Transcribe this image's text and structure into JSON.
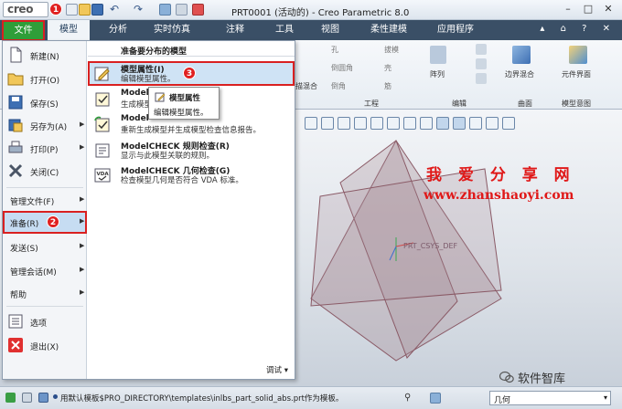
{
  "window": {
    "app_logo": "creo",
    "title": "PRT0001 (活动的) - Creo Parametric 8.0"
  },
  "ribbon": {
    "file_tab": "文件",
    "tabs": [
      "模型",
      "分析",
      "实时仿真",
      "注释",
      "工具",
      "视图",
      "柔性建模",
      "应用程序"
    ],
    "active_tab": "模型",
    "items": [
      "孔",
      "拔模",
      "倒圆角",
      "壳",
      "倒角",
      "筋",
      "阵列",
      "描混合",
      "边界混合",
      "元件界面"
    ],
    "groups": [
      "工程",
      "编辑",
      "曲面",
      "模型意图"
    ]
  },
  "file_menu": {
    "items": [
      {
        "label": "新建(N)",
        "icon": "new-file-icon",
        "arrow": false
      },
      {
        "label": "打开(O)",
        "icon": "open-folder-icon",
        "arrow": false
      },
      {
        "label": "保存(S)",
        "icon": "save-icon",
        "arrow": false
      },
      {
        "label": "另存为(A)",
        "icon": "save-as-icon",
        "arrow": true
      },
      {
        "label": "打印(P)",
        "icon": "print-icon",
        "arrow": true
      },
      {
        "label": "关闭(C)",
        "icon": "close-x-icon",
        "arrow": false
      },
      {
        "label": "管理文件(F)",
        "icon": "",
        "arrow": true
      },
      {
        "label": "准备(R)",
        "icon": "",
        "arrow": true
      },
      {
        "label": "发送(S)",
        "icon": "",
        "arrow": true
      },
      {
        "label": "管理会话(M)",
        "icon": "",
        "arrow": true
      },
      {
        "label": "帮助",
        "icon": "",
        "arrow": true
      },
      {
        "label": "选项",
        "icon": "options-icon",
        "arrow": false
      },
      {
        "label": "退出(X)",
        "icon": "exit-icon",
        "arrow": false
      }
    ],
    "submenu_header": "准备要分布的模型",
    "submenu": [
      {
        "title": "模型属性(I)",
        "desc": "编辑模型属性。",
        "icon": "model-properties-icon"
      },
      {
        "title": "Model",
        "desc": "生成模型 配成绘图)。",
        "icon": "model-check-icon"
      },
      {
        "title": "Model",
        "desc": "重新生成模型并生成模型检查信息报告。",
        "icon": "regenerate-check-icon"
      },
      {
        "title": "ModelCHECK 规则检查(R)",
        "desc": "显示与此模型关联的规则。",
        "icon": "rule-check-icon"
      },
      {
        "title": "ModelCHECK 几何检查(G)",
        "desc": "检查模型几何是否符合 VDA 标准。",
        "icon": "vda-check-icon"
      }
    ],
    "debug_label": "调试"
  },
  "tooltip": {
    "title": "模型属性",
    "desc": "编辑模型属性。"
  },
  "callouts": [
    "1",
    "2",
    "3"
  ],
  "viewport": {
    "csys_label": "PRT_CSYS_DEF",
    "watermark_cn": "我 爱 分 享 网",
    "watermark_url": "www.zhanshaoyi.com",
    "brand": "软件智库"
  },
  "status": {
    "message": "用默认模板$PRO_DIRECTORY\\templates\\inlbs_part_solid_abs.prt作为模板。",
    "filter_value": "几何"
  },
  "colors": {
    "accent_green": "#2f9e39",
    "highlight_red": "#d92020",
    "watermark_red": "#e01818",
    "tab_bar": "#3a4f66",
    "plane_fill": "#a78c96"
  }
}
